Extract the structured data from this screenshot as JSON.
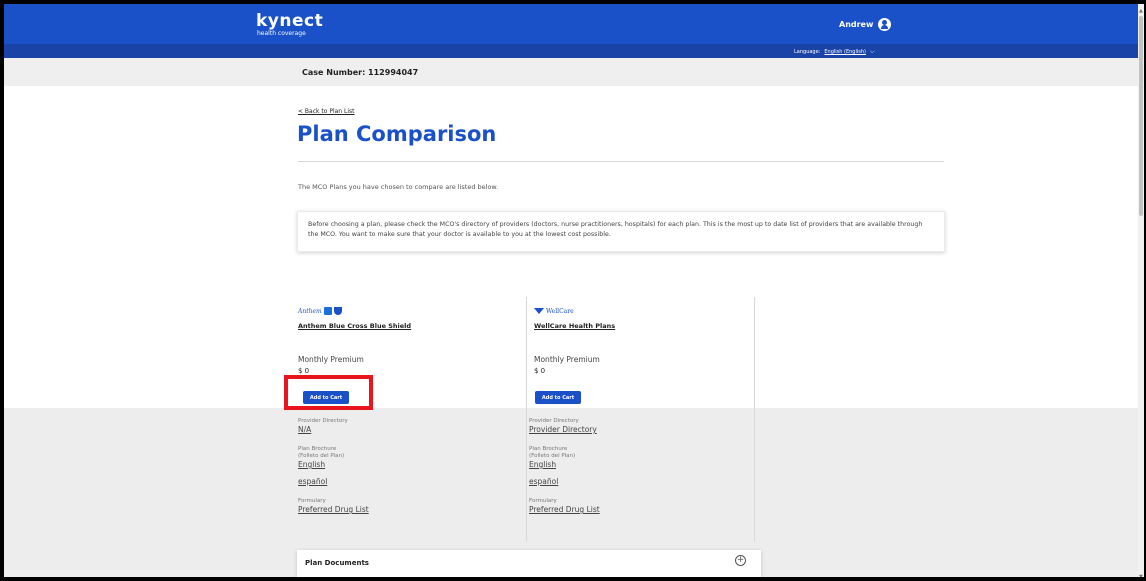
{
  "header": {
    "logo_name": "kynect",
    "logo_sub": "health coverage",
    "user_name": "Andrew",
    "language_label": "Language:",
    "language_value": "English (English)"
  },
  "case_number": "Case Number: 112994047",
  "back_link": "< Back to Plan List",
  "page_title": "Plan Comparison",
  "intro": "The MCO Plans you have chosen to compare are listed below.",
  "notice": "Before choosing a plan, please check the MCO's directory of providers (doctors, nurse practitioners, hospitals) for each plan. This is the most up to date list of providers that are available through the MCO. You want to make sure that your doctor is available to you at the lowest cost possible.",
  "plans": [
    {
      "logo_text": "Anthem",
      "name": "Anthem Blue Cross Blue Shield",
      "premium_label": "Monthly Premium",
      "premium_value": "$ 0",
      "add_label": "Add to Cart",
      "provider_label": "Provider Directory",
      "provider_value": "N/A",
      "brochure_label": "Plan Brochure",
      "brochure_sub": "(Folleto del Plan)",
      "brochure_en": "English",
      "brochure_es": "español",
      "formulary_label": "Formulary",
      "formulary_value": "Preferred Drug List"
    },
    {
      "logo_text": "WellCare",
      "name": "WellCare Health Plans",
      "premium_label": "Monthly Premium",
      "premium_value": "$ 0",
      "add_label": "Add to Cart",
      "provider_label": "Provider Directory",
      "provider_value": "Provider Directory",
      "brochure_label": "Plan Brochure",
      "brochure_sub": "(Folleto del Plan)",
      "brochure_en": "English",
      "brochure_es": "español",
      "formulary_label": "Formulary",
      "formulary_value": "Preferred Drug List"
    }
  ],
  "plan_documents": "Plan Documents",
  "colors": {
    "brand_blue": "#1a50c8",
    "highlight_red": "#e8161c",
    "band_gray": "#ededed"
  }
}
